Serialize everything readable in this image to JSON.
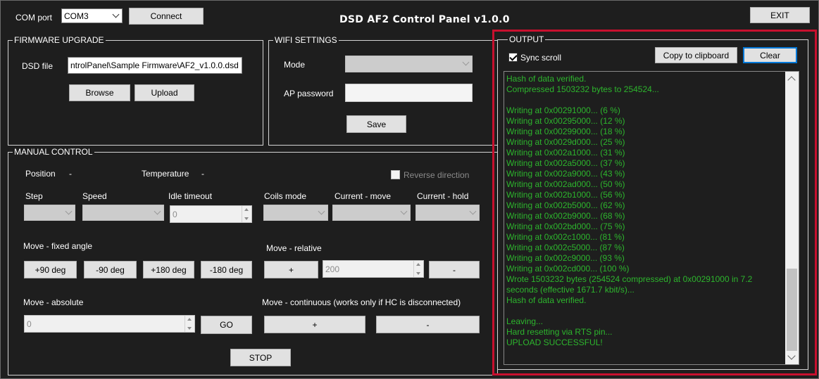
{
  "window": {
    "title": "DSD AF2 Control Panel v1.0.0",
    "exit_label": "EXIT"
  },
  "com": {
    "label": "COM port",
    "port_value": "COM3",
    "connect_label": "Connect"
  },
  "firmware": {
    "title": "FIRMWARE UPGRADE",
    "dsd_label": "DSD file",
    "dsd_value": "ntrolPanel\\Sample Firmware\\AF2_v1.0.0.dsd",
    "browse_label": "Browse",
    "upload_label": "Upload"
  },
  "wifi": {
    "title": "WIFI SETTINGS",
    "mode_label": "Mode",
    "mode_value": "",
    "ap_password_label": "AP password",
    "ap_password_value": "",
    "save_label": "Save"
  },
  "manual": {
    "title": "MANUAL CONTROL",
    "position_label": "Position",
    "position_value": "-",
    "temperature_label": "Temperature",
    "temperature_value": "-",
    "reverse_label": "Reverse direction",
    "step_label": "Step",
    "speed_label": "Speed",
    "idle_timeout_label": "Idle timeout",
    "idle_timeout_value": "0",
    "coils_mode_label": "Coils mode",
    "current_move_label": "Current - move",
    "current_hold_label": "Current - hold",
    "fixed_angle_label": "Move - fixed angle",
    "fixed_angle_buttons": [
      "+90 deg",
      "-90  deg",
      "+180  deg",
      "-180 deg"
    ],
    "relative_label": "Move - relative",
    "relative_plus": "+",
    "relative_value": "200",
    "relative_minus": "-",
    "absolute_label": "Move - absolute",
    "absolute_value": "0",
    "go_label": "GO",
    "continuous_label": "Move - continuous (works only if HC is disconnected)",
    "continuous_plus": "+",
    "continuous_minus": "-",
    "stop_label": "STOP"
  },
  "output": {
    "title": "OUTPUT",
    "sync_scroll_label": "Sync scroll",
    "sync_scroll_checked": true,
    "copy_label": "Copy to clipboard",
    "clear_label": "Clear",
    "log_color": "#2db52d",
    "lines": [
      "Hash of data verified.",
      "Compressed 1503232 bytes to 254524...",
      "",
      "Writing at 0x00291000... (6 %)",
      "Writing at 0x00295000... (12 %)",
      "Writing at 0x00299000... (18 %)",
      "Writing at 0x0029d000... (25 %)",
      "Writing at 0x002a1000... (31 %)",
      "Writing at 0x002a5000... (37 %)",
      "Writing at 0x002a9000... (43 %)",
      "Writing at 0x002ad000... (50 %)",
      "Writing at 0x002b1000... (56 %)",
      "Writing at 0x002b5000... (62 %)",
      "Writing at 0x002b9000... (68 %)",
      "Writing at 0x002bd000... (75 %)",
      "Writing at 0x002c1000... (81 %)",
      "Writing at 0x002c5000... (87 %)",
      "Writing at 0x002c9000... (93 %)",
      "Writing at 0x002cd000... (100 %)",
      "Wrote 1503232 bytes (254524 compressed) at 0x00291000 in 7.2",
      "seconds (effective 1671.7 kbit/s)...",
      "Hash of data verified.",
      "",
      "Leaving...",
      "Hard resetting via RTS pin...",
      "UPLOAD SUCCESSFUL!"
    ]
  },
  "colors": {
    "background": "#1e1e1e",
    "highlight_border": "#c8102e",
    "button_face": "#e1e1e1",
    "focus_border": "#0078d7"
  }
}
